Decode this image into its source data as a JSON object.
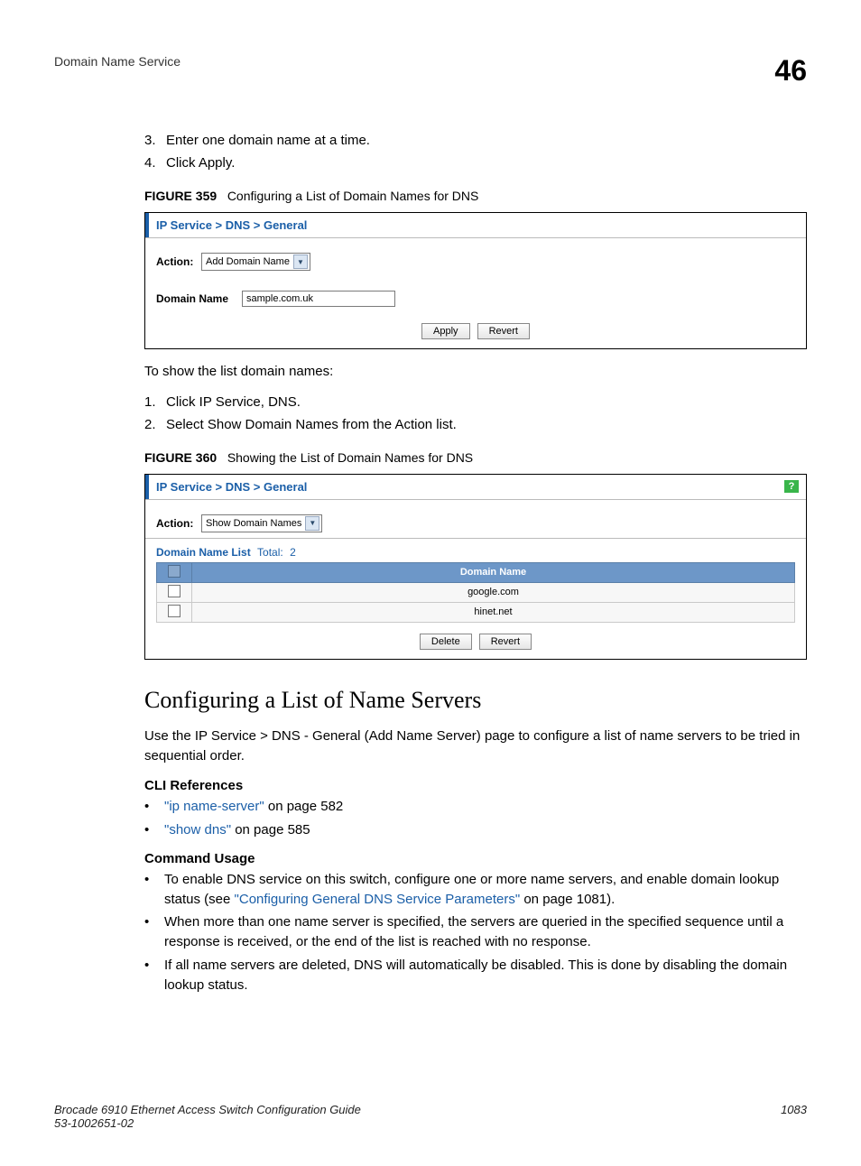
{
  "header": {
    "section": "Domain Name Service",
    "page_marker": "46"
  },
  "steps_top": [
    {
      "n": "3.",
      "text": "Enter one domain name at a time."
    },
    {
      "n": "4.",
      "text": "Click Apply."
    }
  ],
  "figure359": {
    "label": "FIGURE 359",
    "caption": "Configuring a List of Domain Names for DNS",
    "breadcrumb": "IP Service > DNS > General",
    "action_label": "Action:",
    "action_value": "Add Domain Name",
    "field_label": "Domain Name",
    "field_value": "sample.com.uk",
    "apply": "Apply",
    "revert": "Revert"
  },
  "para_show_intro": "To show the list domain names:",
  "steps_show": [
    {
      "n": "1.",
      "text": "Click IP Service, DNS."
    },
    {
      "n": "2.",
      "text": "Select Show Domain Names from the Action list."
    }
  ],
  "figure360": {
    "label": "FIGURE 360",
    "caption": "Showing the List of Domain Names for DNS",
    "breadcrumb": "IP Service > DNS > General",
    "action_label": "Action:",
    "action_value": "Show Domain Names",
    "list_title": "Domain Name List",
    "list_total_label": "Total:",
    "list_total": "2",
    "col_header": "Domain Name",
    "rows": [
      "google.com",
      "hinet.net"
    ],
    "delete": "Delete",
    "revert": "Revert"
  },
  "section_heading": "Configuring a List of Name Servers",
  "section_intro": "Use the IP Service > DNS - General (Add Name Server) page to configure a list of name servers to be tried in sequential order.",
  "cli_refs_head": "CLI References",
  "cli_refs": [
    {
      "link": "\"ip name-server\"",
      "tail": " on page 582"
    },
    {
      "link": "\"show dns\"",
      "tail": " on page 585"
    }
  ],
  "cmd_usage_head": "Command Usage",
  "cmd_usage": [
    {
      "pre": "To enable DNS service on this switch, configure one or more name servers, and enable domain lookup status (see ",
      "link": "\"Configuring General DNS Service Parameters\"",
      "post": " on page 1081)."
    },
    {
      "pre": "When more than one name server is specified, the servers are queried in the specified sequence until a response is received, or the end of the list is reached with no response.",
      "link": "",
      "post": ""
    },
    {
      "pre": "If all name servers are deleted, DNS will automatically be disabled. This is done by disabling the domain lookup status.",
      "link": "",
      "post": ""
    }
  ],
  "footer": {
    "left_line1": "Brocade 6910 Ethernet Access Switch Configuration Guide",
    "left_line2": "53-1002651-02",
    "right": "1083"
  }
}
